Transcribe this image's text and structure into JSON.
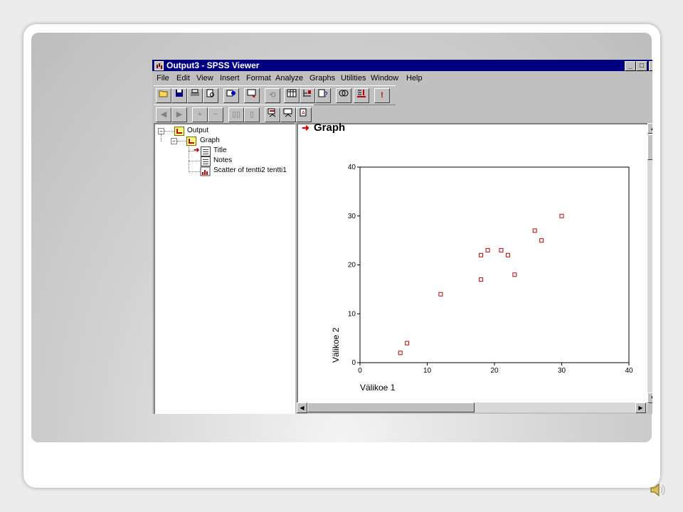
{
  "window": {
    "title": "Output3 - SPSS Viewer",
    "controls": {
      "minimize": "_",
      "maximize": "□",
      "close": "×"
    }
  },
  "menu": [
    "File",
    "Edit",
    "View",
    "Insert",
    "Format",
    "Analyze",
    "Graphs",
    "Utilities",
    "Window",
    "Help"
  ],
  "toolbar1": [
    "open-icon",
    "save-icon",
    "print-icon",
    "print-preview-icon",
    "export-icon",
    "dialog-recall-icon",
    "undo-icon",
    "goto-data-icon",
    "goto-case-icon",
    "variables-icon",
    "use-sets-icon",
    "designate-window-icon",
    "run-icon"
  ],
  "toolbar2": [
    "promote-icon",
    "demote-icon",
    "expand-icon",
    "collapse-icon",
    "show-icon",
    "hide-icon",
    "insert-heading-icon",
    "insert-title-icon",
    "insert-text-icon"
  ],
  "outline": {
    "root": "Output",
    "group": "Graph",
    "items": [
      "Title",
      "Notes",
      "Scatter of tentti2 tentti1"
    ]
  },
  "content": {
    "heading": "Graph"
  },
  "chart_data": {
    "type": "scatter",
    "xlabel": "Välikoe 1",
    "ylabel": "Välikoe 2",
    "xlim": [
      0,
      40
    ],
    "ylim": [
      0,
      40
    ],
    "xticks": [
      0,
      10,
      20,
      30,
      40
    ],
    "yticks": [
      0,
      10,
      20,
      30,
      40
    ],
    "marker_color": "#c00000",
    "points": [
      {
        "x": 6,
        "y": 2
      },
      {
        "x": 7,
        "y": 4
      },
      {
        "x": 12,
        "y": 14
      },
      {
        "x": 18,
        "y": 17
      },
      {
        "x": 18,
        "y": 22
      },
      {
        "x": 19,
        "y": 23
      },
      {
        "x": 21,
        "y": 23
      },
      {
        "x": 22,
        "y": 22
      },
      {
        "x": 23,
        "y": 18
      },
      {
        "x": 26,
        "y": 27
      },
      {
        "x": 27,
        "y": 25
      },
      {
        "x": 30,
        "y": 30
      }
    ]
  }
}
